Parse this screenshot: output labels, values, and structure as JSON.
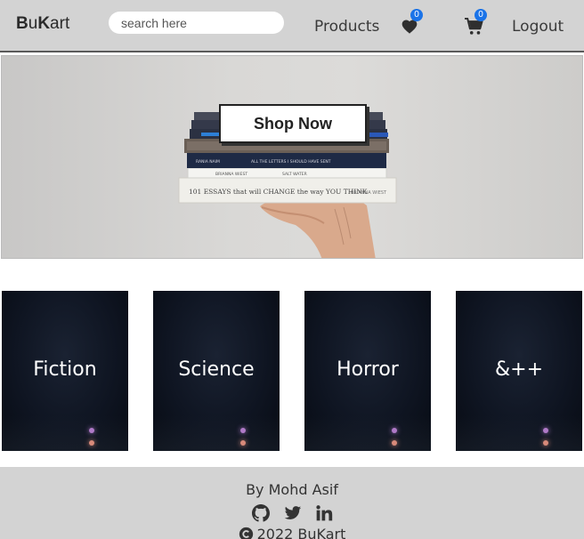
{
  "navbar": {
    "brand_bold_1": "B",
    "brand_light_1": "u",
    "brand_bold_2": "K",
    "brand_light_2": "art",
    "search_placeholder": "search here",
    "products_label": "Products",
    "wishlist_count": "0",
    "cart_count": "0",
    "logout_label": "Logout"
  },
  "hero": {
    "cta_label": "Shop Now",
    "book_titles": [
      "101 ESSAYS that will CHANGE the way YOU THINK",
      "ALL THE LETTERS I SHOULD HAVE SENT"
    ]
  },
  "categories": [
    {
      "label": "Fiction"
    },
    {
      "label": "Science"
    },
    {
      "label": "Horror"
    },
    {
      "label": "&++"
    }
  ],
  "footer": {
    "author": "By Mohd Asif",
    "copyright": "2022 BuKart"
  },
  "colors": {
    "navbar_bg": "#d3d3d3",
    "badge": "#1a73e8",
    "footer_bg": "#d3d3d3",
    "card_bg": "#0f1522"
  }
}
